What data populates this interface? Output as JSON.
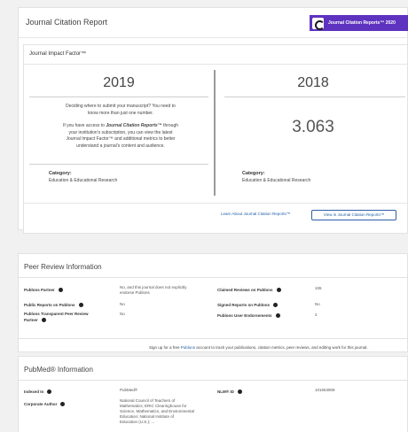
{
  "jcr": {
    "title": "Journal Citation Report",
    "logo_button_label": "Journal Citation Reports™ 2020",
    "impact_factor_label": "Journal Impact Factor™",
    "left": {
      "year": "2019",
      "text_line1": "Deciding where to submit your manuscript? You need to",
      "text_line2": "know more than just one number.",
      "access_prefix": "If you have access to ",
      "access_bold": "Journal Citation Reports™",
      "access_suffix": " through",
      "access_line2": "your institution's subscription, you can view the latest",
      "access_line3": "Journal Impact Factor™ and additional metrics to better",
      "access_line4": "understand a journal's content and audience.",
      "category_label": "Category:",
      "category_value": "Education & Educational Research"
    },
    "right": {
      "year": "2018",
      "value": "3.063",
      "category_label": "Category:",
      "category_value": "Education & Educational Research"
    },
    "learn_link": "Learn About Journal Citation Reports™",
    "view_button": "View in Journal Citation Reports™"
  },
  "peer": {
    "title": "Peer Review Information",
    "publons_partner_label": "Publons Partner",
    "publons_partner_value_line1": "No, and this journal does not explicitly",
    "publons_partner_value_line2": "endorse Publons",
    "public_reports_label": "Public Reports on Publons",
    "public_reports_value": "No",
    "transparent_label_line1": "Publons Transparent Peer Review",
    "transparent_label_line2": "Partner",
    "transparent_value": "No",
    "claimed_reviews_label": "Claimed Reviews on Publons",
    "claimed_reviews_value": "106",
    "signed_reports_label": "Signed Reports on Publons",
    "signed_reports_value": "No",
    "endorsements_label": "Publons User Endorsements",
    "endorsements_value": "2"
  },
  "signup": {
    "prefix": "Sign up for a free ",
    "link": "Publons",
    "suffix": " account to track your publications, citation metrics, peer reviews, and editing work for this journal."
  },
  "pubmed": {
    "title": "PubMed® Information",
    "indexed_label": "Indexed In",
    "indexed_value": "PubMed®",
    "corporate_label": "Corporate Author",
    "corporate_line1": "National Council of Teachers of",
    "corporate_line2": "Mathematics; ERIC Clearinghouse for",
    "corporate_line3": "Science, Mathematics, and Environmental",
    "corporate_line4": "Education; National Institute of",
    "corporate_line5": "Education (U.S.); ...",
    "nlm_label": "NLM® ID",
    "nlm_value": "101653909"
  }
}
